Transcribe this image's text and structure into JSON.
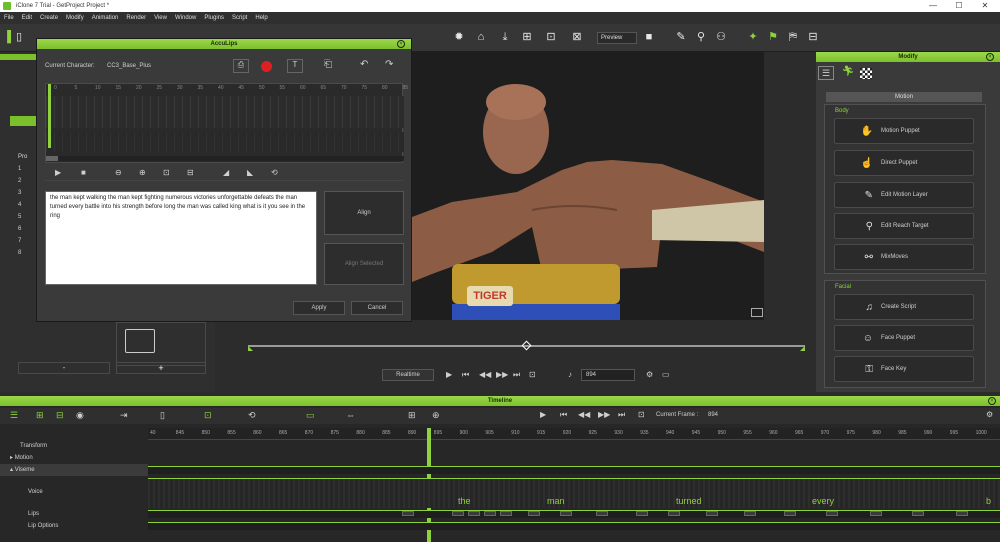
{
  "window": {
    "title": "iClone 7 Trial - GetProject Project *",
    "minimize": "—",
    "maximize": "☐",
    "close": "✕"
  },
  "menu": [
    "File",
    "Edit",
    "Create",
    "Modify",
    "Animation",
    "Render",
    "View",
    "Window",
    "Plugins",
    "Script",
    "Help"
  ],
  "toolbar": {
    "preview_label": "Preview"
  },
  "acculips": {
    "title": "AccuLips",
    "current_character_label": "Current Character:",
    "current_character_value": "CC3_Base_Plus",
    "ruler": [
      "0",
      "5",
      "10",
      "15",
      "20",
      "25",
      "30",
      "35",
      "40",
      "45",
      "50",
      "55",
      "60",
      "65",
      "70",
      "75",
      "80",
      "85"
    ],
    "script_text": "the man kept walking the man kept fighting numerous victories unforgettable defeats the man turned every battle into his strength before long the man was called king what is it you see in the ring",
    "align_label": "Align",
    "align_selected_label": "Align Selected",
    "apply_label": "Apply",
    "cancel_label": "Cancel"
  },
  "left": {
    "rows": [
      "1",
      "2",
      "3",
      "4",
      "5",
      "6",
      "7",
      "8"
    ],
    "list_header": "Pro",
    "minus": "-",
    "plus": "+"
  },
  "viewport": {
    "belt_text": "TIGER",
    "realtime_label": "Realtime",
    "frame_value": "894"
  },
  "modify": {
    "title": "Modify",
    "section_title": "Motion",
    "body_label": "Body",
    "body_buttons": [
      "Motion Puppet",
      "Direct Puppet",
      "Edit Motion Layer",
      "Edit Reach Target",
      "MixMoves"
    ],
    "facial_label": "Facial",
    "facial_buttons": [
      "Create Script",
      "Face Puppet",
      "Face Key"
    ]
  },
  "timeline": {
    "title": "Timeline",
    "current_frame_label": "Current Frame :",
    "current_frame_value": "894",
    "ruler": [
      "40",
      "845",
      "850",
      "855",
      "860",
      "865",
      "870",
      "875",
      "880",
      "885",
      "890",
      "895",
      "900",
      "905",
      "910",
      "915",
      "920",
      "925",
      "930",
      "935",
      "940",
      "945",
      "950",
      "955",
      "960",
      "965",
      "970",
      "975",
      "980",
      "985",
      "990",
      "995",
      "1000"
    ],
    "tracks": [
      "Transform",
      "Motion",
      "Viseme",
      "Voice",
      "Lips",
      "Lip Options"
    ],
    "words": [
      "the",
      "man",
      "turned",
      "every",
      "b"
    ]
  }
}
